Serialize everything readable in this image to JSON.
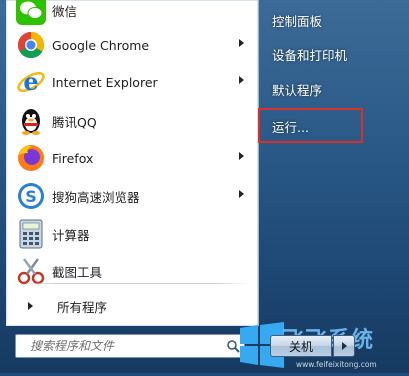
{
  "programs": [
    {
      "label": "微信",
      "icon": "wechat-icon",
      "arrow": false
    },
    {
      "label": "Google Chrome",
      "icon": "chrome-icon",
      "arrow": true
    },
    {
      "label": "Internet Explorer",
      "icon": "internet-explorer-icon",
      "arrow": true
    },
    {
      "label": "腾讯QQ",
      "icon": "qq-penguin-icon",
      "arrow": false
    },
    {
      "label": "Firefox",
      "icon": "firefox-icon",
      "arrow": true
    },
    {
      "label": "搜狗高速浏览器",
      "icon": "sogou-browser-icon",
      "arrow": true
    },
    {
      "label": "计算器",
      "icon": "calculator-icon",
      "arrow": false
    },
    {
      "label": "截图工具",
      "icon": "snipping-tool-icon",
      "arrow": false
    }
  ],
  "all_programs": "所有程序",
  "search": {
    "placeholder": "搜索程序和文件"
  },
  "right_menu": [
    {
      "label": "控制面板"
    },
    {
      "label": "设备和打印机"
    },
    {
      "label": "默认程序"
    },
    {
      "label": "运行..."
    }
  ],
  "shutdown": {
    "label": "关机"
  },
  "watermark": {
    "text": "飞飞系统",
    "url": "www.feifeixitong.com"
  },
  "colors": {
    "highlight": "#d9302c",
    "accent": "#2a5987"
  }
}
